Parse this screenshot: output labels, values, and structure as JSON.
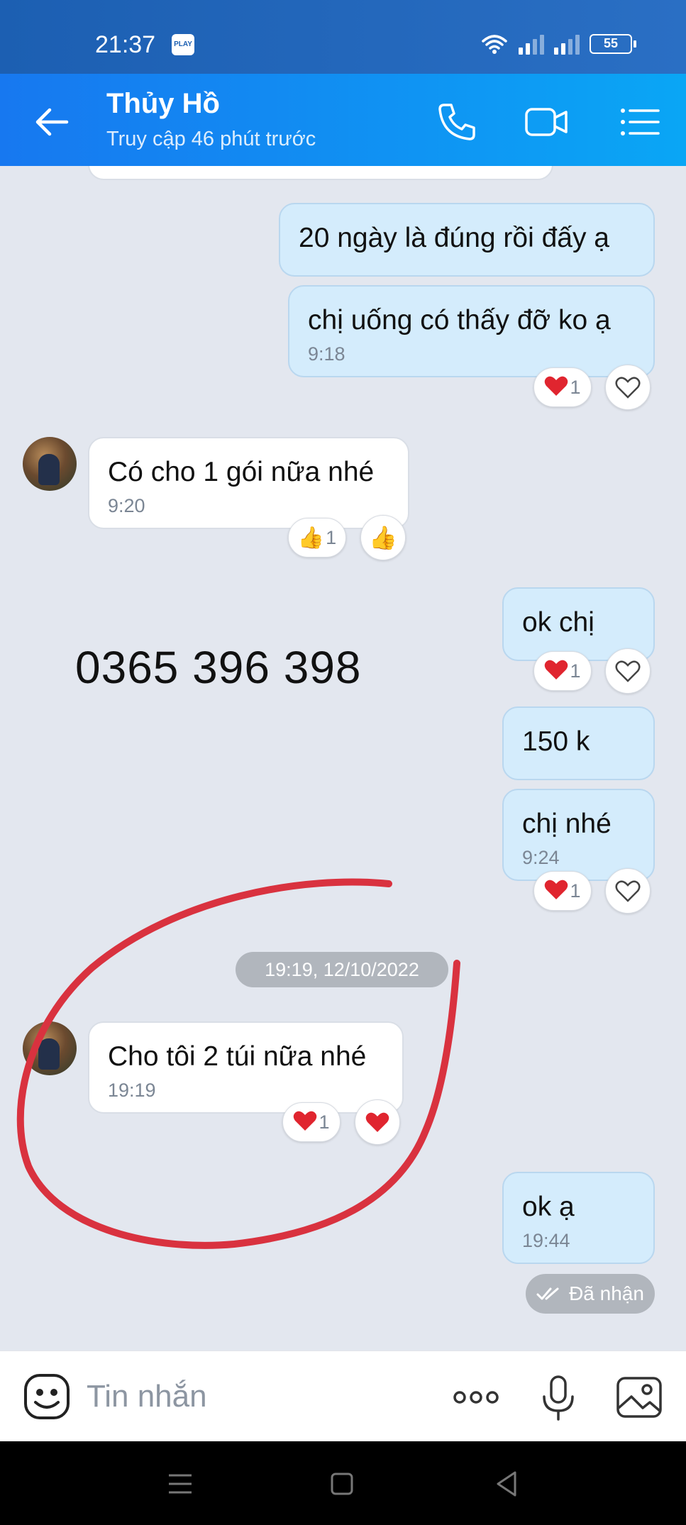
{
  "status_bar": {
    "time": "21:37",
    "app_badge": "PLAY",
    "battery": "55",
    "icons": [
      "wifi-icon",
      "signal-icon",
      "signal-icon",
      "battery-icon"
    ]
  },
  "header": {
    "contact_name": "Thủy Hồ",
    "contact_status": "Truy cập 46 phút trước",
    "icons": [
      "back-arrow-icon",
      "phone-icon",
      "video-call-icon",
      "menu-list-icon"
    ]
  },
  "messages": [
    {
      "side": "me",
      "text": "20 ngày là đúng rồi đấy ạ",
      "time": ""
    },
    {
      "side": "me",
      "text": "chị uống có thấy đỡ ko ạ",
      "time": "9:18",
      "reaction": "❤️",
      "reaction_count": "1"
    },
    {
      "side": "them",
      "text": "Có cho 1 gói nữa nhé",
      "time": "9:20",
      "reaction": "👍",
      "reaction_count": "1"
    },
    {
      "side": "me",
      "text": "ok chị",
      "time": "",
      "reaction": "❤️",
      "reaction_count": "1"
    },
    {
      "side": "me",
      "text": "150 k",
      "time": ""
    },
    {
      "side": "me",
      "text": "chị nhé",
      "time": "9:24",
      "reaction": "❤️",
      "reaction_count": "1"
    },
    {
      "side": "them",
      "text": "Cho tôi 2 túi nữa nhé",
      "time": "19:19",
      "reaction": "❤️",
      "reaction_count": "1"
    },
    {
      "side": "me",
      "text": "ok ạ",
      "time": "19:44"
    }
  ],
  "date_separator": "19:19, 12/10/2022",
  "delivery_status": "Đã nhận",
  "overlay_phone": "0365 396 398",
  "annotation_color": "#d9323f",
  "input": {
    "placeholder": "Tin nhắn",
    "icons": [
      "emoji-icon",
      "more-dots-icon",
      "microphone-icon",
      "image-icon"
    ]
  },
  "colors": {
    "header_start": "#1778f0",
    "header_end": "#0aa6f5",
    "my_bubble": "#d4ecfc",
    "their_bubble": "#ffffff",
    "chat_bg": "#e3e7ef"
  }
}
